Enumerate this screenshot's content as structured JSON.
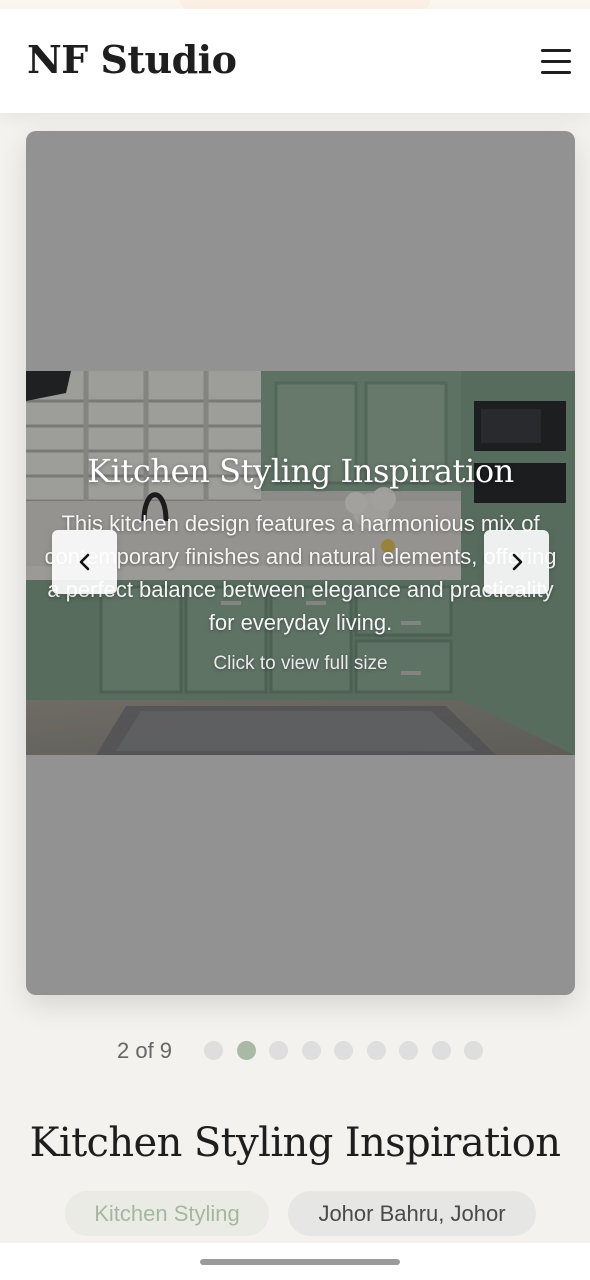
{
  "header": {
    "logo": "NF Studio",
    "menu_icon": "hamburger-menu-icon"
  },
  "carousel": {
    "slide": {
      "title": "Kitchen Styling Inspiration",
      "description": "This kitchen design features a harmonious mix of contemporary finishes and natural elements, offering a perfect balance between elegance and practicality for everyday living.",
      "hint": "Click to view full size"
    },
    "prev_icon": "chevron-left-icon",
    "next_icon": "chevron-right-icon"
  },
  "pager": {
    "counter": "2 of 9",
    "total": 9,
    "current": 2
  },
  "project": {
    "title": "Kitchen Styling Inspiration",
    "category": "Kitchen Styling",
    "location": "Johor Bahru, Johor"
  },
  "colors": {
    "accent_sage": "#a9b9a6",
    "cabinet_green": "#8fae98",
    "background": "#f3f2ee"
  }
}
